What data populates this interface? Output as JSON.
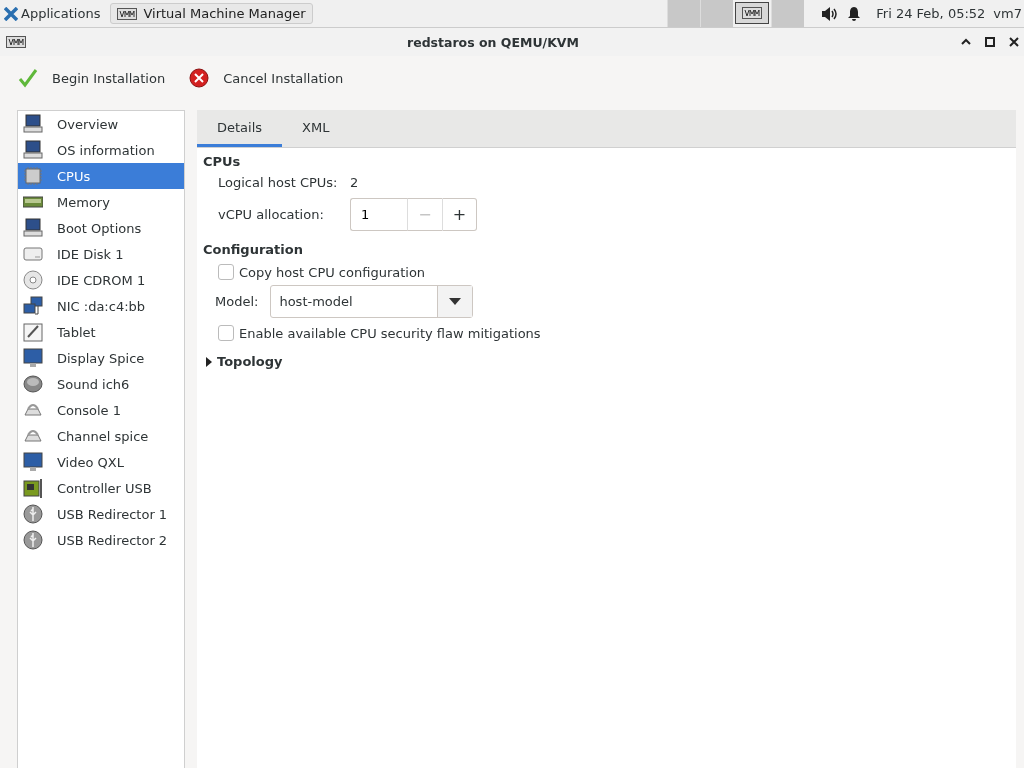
{
  "panel": {
    "menu": "Applications",
    "tasks": [
      {
        "label": "Virtual Machine Manager",
        "selected": true
      }
    ],
    "workspaces": [
      {
        "selected": false
      },
      {
        "selected": false
      },
      {
        "selected": true
      },
      {
        "selected": false
      }
    ],
    "clock": "Fri 24 Feb, 05:52",
    "user": "vm7"
  },
  "window": {
    "title": "redstaros on QEMU/KVM"
  },
  "toolbar": [
    {
      "label": "Begin Installation",
      "kind": "ok"
    },
    {
      "label": "Cancel Installation",
      "kind": "cancel"
    }
  ],
  "sidebar": {
    "items": [
      {
        "label": "Overview",
        "kind": "computer",
        "selected": false
      },
      {
        "label": "OS information",
        "kind": "computer",
        "selected": false
      },
      {
        "label": "CPUs",
        "kind": "chip",
        "selected": true
      },
      {
        "label": "Memory",
        "kind": "memory",
        "selected": false
      },
      {
        "label": "Boot Options",
        "kind": "computer",
        "selected": false
      },
      {
        "label": "IDE Disk 1",
        "kind": "disk",
        "selected": false
      },
      {
        "label": "IDE CDROM 1",
        "kind": "cdrom",
        "selected": false
      },
      {
        "label": "NIC :da:c4:bb",
        "kind": "network",
        "selected": false
      },
      {
        "label": "Tablet",
        "kind": "tablet",
        "selected": false
      },
      {
        "label": "Display Spice",
        "kind": "monitor",
        "selected": false
      },
      {
        "label": "Sound ich6",
        "kind": "sound",
        "selected": false
      },
      {
        "label": "Console 1",
        "kind": "serial",
        "selected": false
      },
      {
        "label": "Channel spice",
        "kind": "serial",
        "selected": false
      },
      {
        "label": "Video QXL",
        "kind": "monitor",
        "selected": false
      },
      {
        "label": "Controller USB",
        "kind": "card",
        "selected": false
      },
      {
        "label": "USB Redirector 1",
        "kind": "usb",
        "selected": false
      },
      {
        "label": "USB Redirector 2",
        "kind": "usb",
        "selected": false
      }
    ]
  },
  "tabs": [
    {
      "label": "Details",
      "selected": true
    },
    {
      "label": "XML",
      "selected": false
    }
  ],
  "cpus": {
    "heading": "CPUs",
    "host_label": "Logical host CPUs:",
    "host_value": "2",
    "alloc_label": "vCPU allocation:",
    "alloc_value": "1",
    "minus": "−",
    "plus": "+",
    "minus_disabled": true
  },
  "configuration": {
    "heading": "Configuration",
    "copy_host": {
      "label": "Copy host CPU configuration",
      "checked": false
    },
    "model_label": "Model:",
    "model_value": "host-model",
    "mitigations": {
      "label": "Enable available CPU security flaw mitigations",
      "checked": false
    }
  },
  "topology": {
    "label": "Topology",
    "expanded": false
  }
}
